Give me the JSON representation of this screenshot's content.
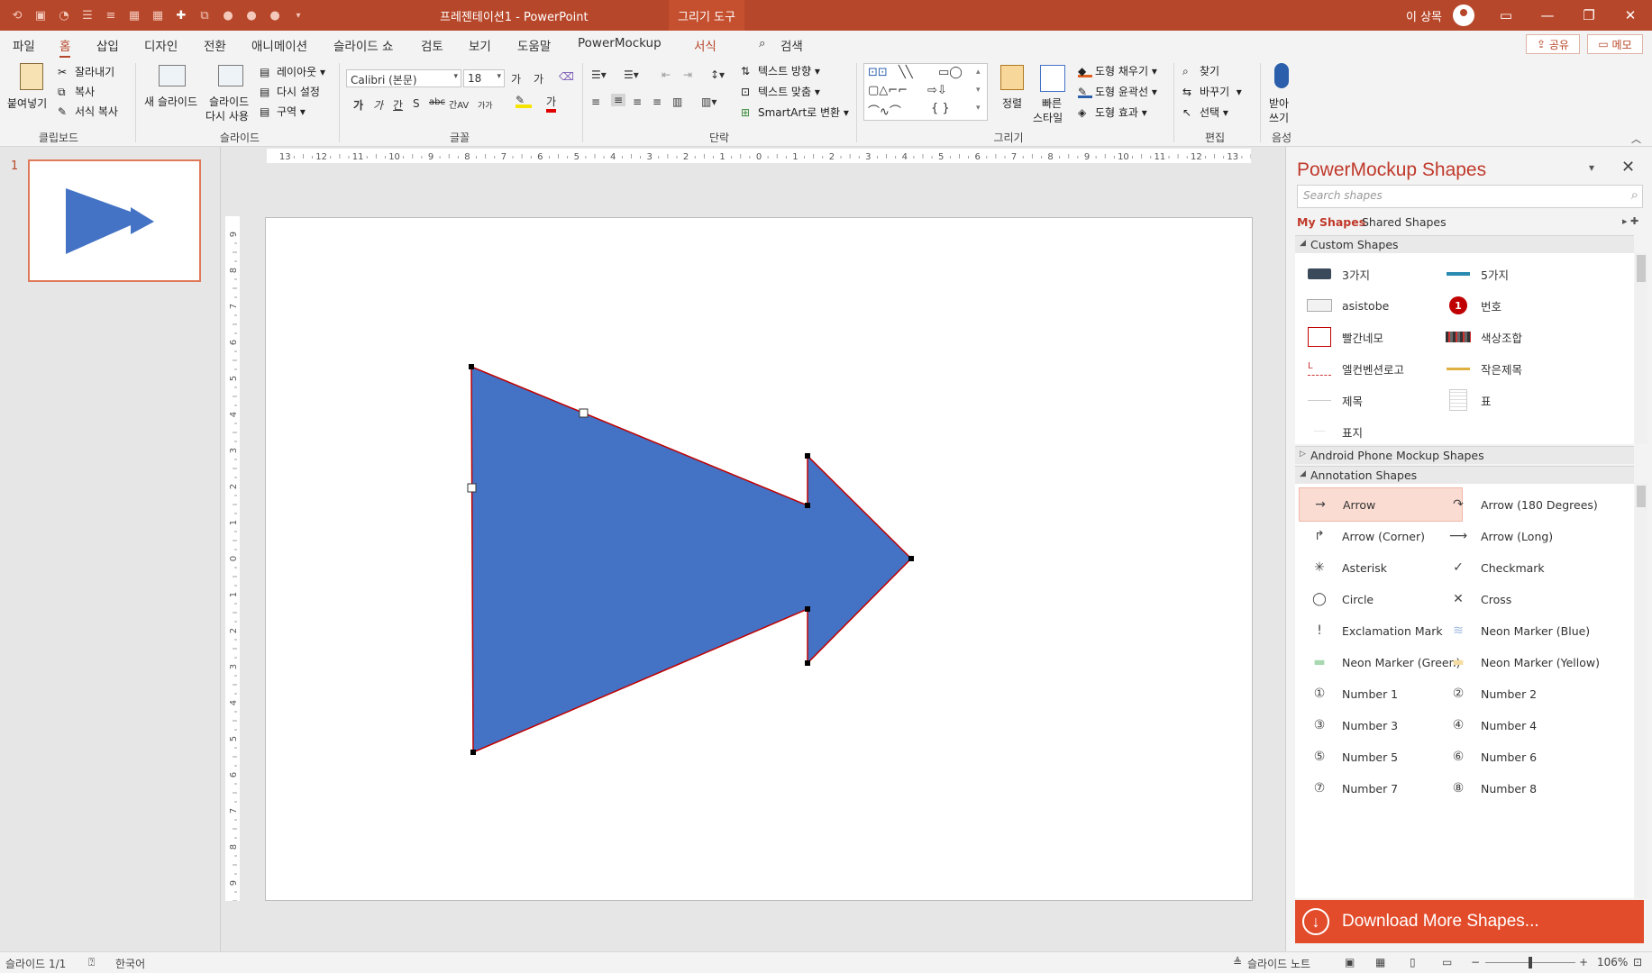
{
  "titlebar": {
    "qat_icons": [
      "undo-icon",
      "redo-icon",
      "repeat-icon",
      "bullets-icon",
      "numbering-icon",
      "table-icon",
      "table2-icon",
      "add-icon",
      "group-icon",
      "shape-icon",
      "shape2-icon",
      "shape3-icon",
      "customize-icon"
    ],
    "doc_title": "프레젠테이션1  -  PowerPoint",
    "context_tab": "그리기 도구",
    "user_name": "이 상목",
    "accent_color": "#b7472a"
  },
  "menu": {
    "tabs": [
      "파일",
      "홈",
      "삽입",
      "디자인",
      "전환",
      "애니메이션",
      "슬라이드 쇼",
      "검토",
      "보기",
      "도움말",
      "PowerMockup",
      "서식"
    ],
    "active_tab": "홈",
    "search_label": "검색",
    "share_label": "공유",
    "memo_label": "메모"
  },
  "ribbon": {
    "clipboard": {
      "paste": "붙여넣기",
      "cut": "잘라내기",
      "copy": "복사",
      "format_painter": "서식 복사",
      "label": "클립보드"
    },
    "slides": {
      "new_slide": "새 슬라이드",
      "reuse_line1": "슬라이드",
      "reuse_line2": "다시 사용",
      "layout": "레이아웃",
      "reset": "다시 설정",
      "section": "구역",
      "label": "슬라이드"
    },
    "font": {
      "font_name": "Calibri (본문)",
      "font_size": "18",
      "grow": "가",
      "shrink": "가",
      "bold": "가",
      "italic": "가",
      "underline": "간",
      "shadow": "S",
      "strike": "abc",
      "spacing": "간AV",
      "case": "가가",
      "font_color": "가",
      "label": "글꼴"
    },
    "paragraph": {
      "text_direction": "텍스트 방향",
      "align_text": "텍스트 맞춤",
      "smartart": "SmartArt로 변환",
      "label": "단락"
    },
    "drawing": {
      "arrange": "정렬",
      "quick_styles_line1": "빠른",
      "quick_styles_line2": "스타일",
      "shape_fill": "도형 채우기",
      "shape_outline": "도형 윤곽선",
      "shape_effects": "도형 효과",
      "label": "그리기"
    },
    "editing": {
      "find": "찾기",
      "replace": "바꾸기",
      "select": "선택",
      "label": "편집"
    },
    "voice": {
      "dictate_line1": "받아",
      "dictate_line2": "쓰기",
      "label": "음성"
    }
  },
  "thumbnails": {
    "slide_number": "1"
  },
  "ruler": {
    "h_ticks": [
      "13",
      "12",
      "11",
      "10",
      "9",
      "8",
      "7",
      "6",
      "5",
      "4",
      "3",
      "2",
      "1",
      "0",
      "1",
      "2",
      "3",
      "4",
      "5",
      "6",
      "7",
      "8",
      "9",
      "10",
      "11",
      "12",
      "13"
    ],
    "v_ticks": [
      "9",
      "8",
      "7",
      "6",
      "5",
      "4",
      "3",
      "2",
      "1",
      "0",
      "1",
      "2",
      "3",
      "4",
      "5",
      "6",
      "7",
      "8",
      "9"
    ]
  },
  "slide": {
    "shape_fill": "#4472c4",
    "shape_outline": "#c00000"
  },
  "pm": {
    "title": "PowerMockup Shapes",
    "search_placeholder": "Search shapes",
    "tab_my": "My Shapes",
    "tab_shared": "Shared Shapes",
    "sections": {
      "custom": "Custom Shapes",
      "android": "Android Phone Mockup Shapes",
      "annotation": "Annotation Shapes"
    },
    "custom_items": [
      "3가지",
      "5가지",
      "asistobe",
      "번호",
      "빨간네모",
      "색상조합",
      "엘컨벤션로고",
      "작은제목",
      "제목",
      "표",
      "표지"
    ],
    "annotation_items": [
      "Arrow",
      "Arrow (180 Degrees)",
      "Arrow (Corner)",
      "Arrow (Long)",
      "Asterisk",
      "Checkmark",
      "Circle",
      "Cross",
      "Exclamation Mark",
      "Neon Marker (Blue)",
      "Neon Marker (Green)",
      "Neon Marker (Yellow)",
      "Number 1",
      "Number 2",
      "Number 3",
      "Number 4",
      "Number 5",
      "Number 6",
      "Number 7",
      "Number 8"
    ],
    "selected_item": "Arrow",
    "download": "Download More Shapes..."
  },
  "status": {
    "slide_count": "슬라이드 1/1",
    "language": "한국어",
    "notes": "슬라이드 노트",
    "zoom": "106%"
  }
}
